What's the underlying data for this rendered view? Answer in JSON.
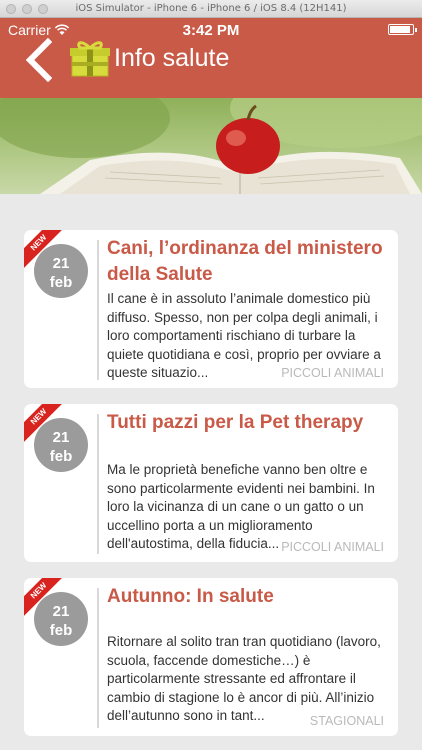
{
  "simulator": {
    "title": "iOS Simulator - iPhone 6 - iPhone 6 / iOS 8.4 (12H141)"
  },
  "status_bar": {
    "carrier": "Carrier",
    "time": "3:42 PM"
  },
  "nav": {
    "title": "Info salute",
    "back_icon": "chevron-left-icon",
    "logo_icon": "gift-icon"
  },
  "colors": {
    "header": "#c95a48",
    "accent": "#c95a48",
    "ribbon": "#d8231f",
    "date_badge": "#9b9b9b"
  },
  "articles": [
    {
      "badge": "NEW",
      "day": "21",
      "month": "feb",
      "title": "Cani, l’ordinanza del ministero della Salute",
      "excerpt": "Il cane è in assoluto l’animale domestico più diffuso. Spesso, non per colpa degli animali, i loro comportamenti rischiano di turbare la quiete quotidiana e così, proprio per ovviare a queste situazio...",
      "category": "PICCOLI ANIMALI"
    },
    {
      "badge": "NEW",
      "day": "21",
      "month": "feb",
      "title": "Tutti pazzi per la Pet therapy",
      "excerpt": "Ma le proprietà benefiche vanno ben oltre e sono particolarmente evidenti nei bambini. In loro la vicinanza di un cane o un gatto o un uccellino porta a un miglioramento dell'autostima, della fiducia...",
      "category": "PICCOLI ANIMALI"
    },
    {
      "badge": "NEW",
      "day": "21",
      "month": "feb",
      "title": "Autunno: In salute",
      "excerpt": "Ritornare al solito tran tran quotidiano (lavoro, scuola, faccende domestiche…) è particolarmente stressante ed affrontare il cambio di stagione lo è ancor di più. All’inizio dell’autunno sono in tant...",
      "category": "STAGIONALI"
    }
  ]
}
